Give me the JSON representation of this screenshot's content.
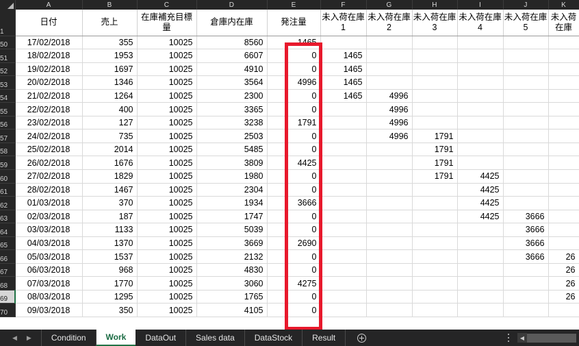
{
  "app": {
    "type": "spreadsheet"
  },
  "grid": {
    "corner_icon": "select-all-triangle-icon",
    "columns": [
      {
        "letter": "A",
        "header": "日付"
      },
      {
        "letter": "B",
        "header": "売上"
      },
      {
        "letter": "C",
        "header": "在庫補充目標量"
      },
      {
        "letter": "D",
        "header": "倉庫内在庫"
      },
      {
        "letter": "E",
        "header": "発注量"
      },
      {
        "letter": "F",
        "header": "未入荷在庫1"
      },
      {
        "letter": "G",
        "header": "未入荷在庫2"
      },
      {
        "letter": "H",
        "header": "未入荷在庫3"
      },
      {
        "letter": "I",
        "header": "未入荷在庫4"
      },
      {
        "letter": "J",
        "header": "未入荷在庫5"
      },
      {
        "letter": "K",
        "header": "未入荷在庫"
      }
    ],
    "header_row_number": "1",
    "selected_row_number": "69",
    "highlight_color": "#e8192c",
    "highlight_column": "E",
    "rows": [
      {
        "n": "50",
        "A": "17/02/2018",
        "B": "355",
        "C": "10025",
        "D": "8560",
        "E": "1465",
        "F": "",
        "G": "",
        "H": "",
        "I": "",
        "J": "",
        "K": ""
      },
      {
        "n": "51",
        "A": "18/02/2018",
        "B": "1953",
        "C": "10025",
        "D": "6607",
        "E": "0",
        "F": "1465",
        "G": "",
        "H": "",
        "I": "",
        "J": "",
        "K": ""
      },
      {
        "n": "52",
        "A": "19/02/2018",
        "B": "1697",
        "C": "10025",
        "D": "4910",
        "E": "0",
        "F": "1465",
        "G": "",
        "H": "",
        "I": "",
        "J": "",
        "K": ""
      },
      {
        "n": "53",
        "A": "20/02/2018",
        "B": "1346",
        "C": "10025",
        "D": "3564",
        "E": "4996",
        "F": "1465",
        "G": "",
        "H": "",
        "I": "",
        "J": "",
        "K": ""
      },
      {
        "n": "54",
        "A": "21/02/2018",
        "B": "1264",
        "C": "10025",
        "D": "2300",
        "E": "0",
        "F": "1465",
        "G": "4996",
        "H": "",
        "I": "",
        "J": "",
        "K": ""
      },
      {
        "n": "55",
        "A": "22/02/2018",
        "B": "400",
        "C": "10025",
        "D": "3365",
        "E": "0",
        "F": "",
        "G": "4996",
        "H": "",
        "I": "",
        "J": "",
        "K": ""
      },
      {
        "n": "56",
        "A": "23/02/2018",
        "B": "127",
        "C": "10025",
        "D": "3238",
        "E": "1791",
        "F": "",
        "G": "4996",
        "H": "",
        "I": "",
        "J": "",
        "K": ""
      },
      {
        "n": "57",
        "A": "24/02/2018",
        "B": "735",
        "C": "10025",
        "D": "2503",
        "E": "0",
        "F": "",
        "G": "4996",
        "H": "1791",
        "I": "",
        "J": "",
        "K": ""
      },
      {
        "n": "58",
        "A": "25/02/2018",
        "B": "2014",
        "C": "10025",
        "D": "5485",
        "E": "0",
        "F": "",
        "G": "",
        "H": "1791",
        "I": "",
        "J": "",
        "K": ""
      },
      {
        "n": "59",
        "A": "26/02/2018",
        "B": "1676",
        "C": "10025",
        "D": "3809",
        "E": "4425",
        "F": "",
        "G": "",
        "H": "1791",
        "I": "",
        "J": "",
        "K": ""
      },
      {
        "n": "60",
        "A": "27/02/2018",
        "B": "1829",
        "C": "10025",
        "D": "1980",
        "E": "0",
        "F": "",
        "G": "",
        "H": "1791",
        "I": "4425",
        "J": "",
        "K": ""
      },
      {
        "n": "61",
        "A": "28/02/2018",
        "B": "1467",
        "C": "10025",
        "D": "2304",
        "E": "0",
        "F": "",
        "G": "",
        "H": "",
        "I": "4425",
        "J": "",
        "K": ""
      },
      {
        "n": "62",
        "A": "01/03/2018",
        "B": "370",
        "C": "10025",
        "D": "1934",
        "E": "3666",
        "F": "",
        "G": "",
        "H": "",
        "I": "4425",
        "J": "",
        "K": ""
      },
      {
        "n": "63",
        "A": "02/03/2018",
        "B": "187",
        "C": "10025",
        "D": "1747",
        "E": "0",
        "F": "",
        "G": "",
        "H": "",
        "I": "4425",
        "J": "3666",
        "K": ""
      },
      {
        "n": "64",
        "A": "03/03/2018",
        "B": "1133",
        "C": "10025",
        "D": "5039",
        "E": "0",
        "F": "",
        "G": "",
        "H": "",
        "I": "",
        "J": "3666",
        "K": ""
      },
      {
        "n": "65",
        "A": "04/03/2018",
        "B": "1370",
        "C": "10025",
        "D": "3669",
        "E": "2690",
        "F": "",
        "G": "",
        "H": "",
        "I": "",
        "J": "3666",
        "K": ""
      },
      {
        "n": "66",
        "A": "05/03/2018",
        "B": "1537",
        "C": "10025",
        "D": "2132",
        "E": "0",
        "F": "",
        "G": "",
        "H": "",
        "I": "",
        "J": "3666",
        "K": "26"
      },
      {
        "n": "67",
        "A": "06/03/2018",
        "B": "968",
        "C": "10025",
        "D": "4830",
        "E": "0",
        "F": "",
        "G": "",
        "H": "",
        "I": "",
        "J": "",
        "K": "26"
      },
      {
        "n": "68",
        "A": "07/03/2018",
        "B": "1770",
        "C": "10025",
        "D": "3060",
        "E": "4275",
        "F": "",
        "G": "",
        "H": "",
        "I": "",
        "J": "",
        "K": "26"
      },
      {
        "n": "69",
        "A": "08/03/2018",
        "B": "1295",
        "C": "10025",
        "D": "1765",
        "E": "0",
        "F": "",
        "G": "",
        "H": "",
        "I": "",
        "J": "",
        "K": "26"
      },
      {
        "n": "70",
        "A": "09/03/2018",
        "B": "350",
        "C": "10025",
        "D": "4105",
        "E": "0",
        "F": "",
        "G": "",
        "H": "",
        "I": "",
        "J": "",
        "K": ""
      }
    ]
  },
  "tabbar": {
    "prev_icon": "prev-sheet-arrow-icon",
    "next_icon": "next-sheet-arrow-icon",
    "tabs": [
      {
        "label": "Condition",
        "active": false
      },
      {
        "label": "Work",
        "active": true
      },
      {
        "label": "DataOut",
        "active": false
      },
      {
        "label": "Sales data",
        "active": false
      },
      {
        "label": "DataStock",
        "active": false
      },
      {
        "label": "Result",
        "active": false
      }
    ],
    "add_sheet_icon": "add-sheet-plus-icon",
    "overflow_icon": "kebab-menu-icon",
    "scroll_left_icon": "scroll-left-arrow-icon"
  }
}
